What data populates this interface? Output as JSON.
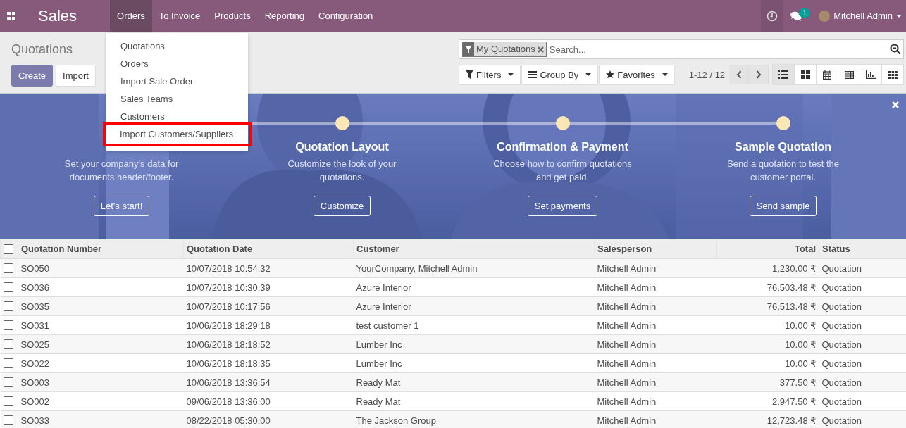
{
  "navbar": {
    "app_name": "Sales",
    "menu": [
      {
        "label": "Orders",
        "selected": true
      },
      {
        "label": "To Invoice",
        "selected": false
      },
      {
        "label": "Products",
        "selected": false
      },
      {
        "label": "Reporting",
        "selected": false
      },
      {
        "label": "Configuration",
        "selected": false
      }
    ],
    "message_count": "1",
    "user": "Mitchell Admin"
  },
  "orders_menu": [
    {
      "label": "Quotations",
      "highlighted": false
    },
    {
      "label": "Orders",
      "highlighted": false
    },
    {
      "label": "Import Sale Order",
      "highlighted": false
    },
    {
      "label": "Sales Teams",
      "highlighted": false
    },
    {
      "label": "Customers",
      "highlighted": false
    },
    {
      "label": "Import Customers/Suppliers",
      "highlighted": true
    }
  ],
  "control_panel": {
    "title": "Quotations",
    "buttons": [
      "Create",
      "Import"
    ],
    "search": {
      "facet": "My Quotations",
      "placeholder": "Search..."
    },
    "dropdowns": [
      "Filters",
      "Group By",
      "Favorites"
    ],
    "pager": "1-12 / 12",
    "views": [
      {
        "kind": "list",
        "selected": true
      },
      {
        "kind": "kanban",
        "selected": false
      },
      {
        "kind": "calendar",
        "selected": false
      },
      {
        "kind": "pivot",
        "selected": false
      },
      {
        "kind": "graph",
        "selected": false
      },
      {
        "kind": "grid",
        "selected": false
      }
    ]
  },
  "onboarding": {
    "steps": [
      {
        "text": "Set your company's data for documents header/footer.",
        "button": "Let's start!"
      },
      {
        "title": "Quotation Layout",
        "text": "Customize the look of your quotations.",
        "button": "Customize"
      },
      {
        "title": "Confirmation & Payment",
        "text": "Choose how to confirm quotations and get paid.",
        "button": "Set payments"
      },
      {
        "title": "Sample Quotation",
        "text": "Send a quotation to test the customer portal.",
        "button": "Send sample"
      }
    ]
  },
  "table": {
    "select_all_checked": false,
    "columns": [
      "Quotation Number",
      "Quotation Date",
      "Customer",
      "Salesperson",
      "Total",
      "Status"
    ],
    "rows": [
      {
        "checked": false,
        "cells": [
          "SO050",
          "10/07/2018 10:54:32",
          "YourCompany, Mitchell Admin",
          "Mitchell Admin",
          "1,230.00 ₹",
          "Quotation"
        ]
      },
      {
        "checked": false,
        "cells": [
          "SO036",
          "10/07/2018 10:30:39",
          "Azure Interior",
          "Mitchell Admin",
          "76,503.48 ₹",
          "Quotation"
        ]
      },
      {
        "checked": false,
        "cells": [
          "SO035",
          "10/07/2018 10:17:56",
          "Azure Interior",
          "Mitchell Admin",
          "76,513.48 ₹",
          "Quotation"
        ]
      },
      {
        "checked": false,
        "cells": [
          "SO031",
          "10/06/2018 18:29:18",
          "test customer 1",
          "Mitchell Admin",
          "10.00 ₹",
          "Quotation"
        ]
      },
      {
        "checked": false,
        "cells": [
          "SO025",
          "10/06/2018 18:18:52",
          "Lumber Inc",
          "Mitchell Admin",
          "10.00 ₹",
          "Quotation"
        ]
      },
      {
        "checked": false,
        "cells": [
          "SO022",
          "10/06/2018 18:18:35",
          "Lumber Inc",
          "Mitchell Admin",
          "10.00 ₹",
          "Quotation"
        ]
      },
      {
        "checked": false,
        "cells": [
          "SO003",
          "10/06/2018 13:36:54",
          "Ready Mat",
          "Mitchell Admin",
          "377.50 ₹",
          "Quotation"
        ]
      },
      {
        "checked": false,
        "cells": [
          "SO002",
          "09/06/2018 13:36:00",
          "Ready Mat",
          "Mitchell Admin",
          "2,947.50 ₹",
          "Quotation"
        ]
      },
      {
        "checked": false,
        "cells": [
          "SO033",
          "08/22/2018 05:30:00",
          "The Jackson Group",
          "Mitchell Admin",
          "12,723.48 ₹",
          "Quotation"
        ]
      }
    ]
  }
}
